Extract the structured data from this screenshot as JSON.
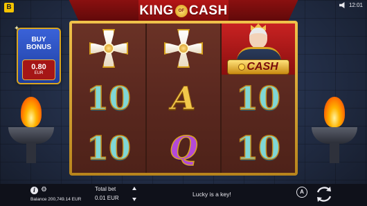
{
  "header": {
    "brand_badge": "B",
    "time": "12:01",
    "logo": {
      "left": "KING",
      "of": "OF",
      "right": "CASH"
    }
  },
  "buy_bonus": {
    "label_1": "BUY",
    "label_2": "BONUS",
    "price": "0.80",
    "currency": "EUR"
  },
  "reels": [
    [
      "cross",
      "10",
      "10"
    ],
    [
      "cross",
      "A",
      "Q"
    ],
    [
      "king-cash",
      "10",
      "10"
    ]
  ],
  "symbols": {
    "cash_text": "CASH"
  },
  "footer": {
    "balance": "Balance 200,749.14 EUR",
    "total_bet_label": "Total bet",
    "total_bet_value": "0.01 EUR",
    "message": "Lucky is a key!",
    "auto_label": "A"
  }
}
